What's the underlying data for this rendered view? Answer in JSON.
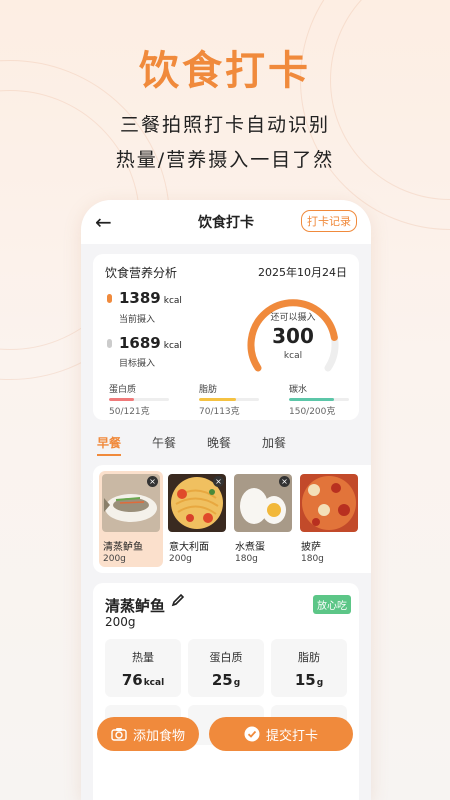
{
  "promo": {
    "title": "饮食打卡",
    "line1": "三餐拍照打卡自动识别",
    "line2": "热量/营养摄入一目了然"
  },
  "nav": {
    "back": "←",
    "title": "饮食打卡",
    "record": "打卡记录"
  },
  "analysis": {
    "heading": "饮食营养分析",
    "date": "2025年10月24日",
    "current_value": "1389",
    "current_unit": "kcal",
    "current_label": "当前摄入",
    "target_value": "1689",
    "target_unit": "kcal",
    "target_label": "目标摄入",
    "remain_label": "还可以摄入",
    "remain_value": "300",
    "remain_unit": "kcal",
    "nutrients": [
      {
        "name": "蛋白质",
        "value": "50/121克",
        "ratio": 0.41,
        "color": "#f07a7a"
      },
      {
        "name": "脂肪",
        "value": "70/113克",
        "ratio": 0.62,
        "color": "#f5c242"
      },
      {
        "name": "碳水",
        "value": "150/200克",
        "ratio": 0.75,
        "color": "#5cc6a8"
      }
    ]
  },
  "meal_tabs": [
    "早餐",
    "午餐",
    "晚餐",
    "加餐"
  ],
  "foods": [
    {
      "name": "清蒸鲈鱼",
      "weight": "200g",
      "remove": "×"
    },
    {
      "name": "意大利面",
      "weight": "200g",
      "remove": "×"
    },
    {
      "name": "水煮蛋",
      "weight": "180g",
      "remove": "×"
    },
    {
      "name": "披萨",
      "weight": "180g"
    }
  ],
  "detail": {
    "name": "清蒸鲈鱼",
    "weight": "200g",
    "badge": "放心吃",
    "stats": [
      {
        "name": "热量",
        "value": "76",
        "unit": "kcal"
      },
      {
        "name": "蛋白质",
        "value": "25",
        "unit": "g"
      },
      {
        "name": "脂肪",
        "value": "15",
        "unit": "g"
      }
    ]
  },
  "buttons": {
    "add": "添加食物",
    "submit": "提交打卡"
  },
  "colors": {
    "accent": "#f08a3c",
    "badge": "#5cc687"
  }
}
